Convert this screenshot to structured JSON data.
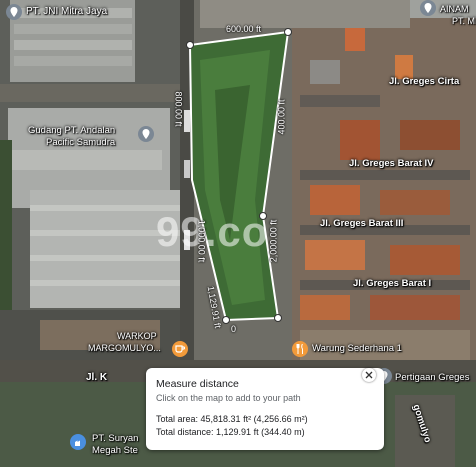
{
  "place_labels": {
    "pt_jni": "PT. JNI Mitra Jaya",
    "ainam": "AINAM",
    "pt_mi": "PT. MI",
    "gudang_1": "Gudang PT. Andalan",
    "gudang_2": "Pacific Samudra",
    "warkop_1": "WARKOP",
    "warkop_2": "MARGOMULYO...",
    "warung": "Warung Sederhana 1",
    "pertigaan": "Pertigaan Greges",
    "pt_suryan_1": "PT. Suryan",
    "pt_suryan_2": "Megah Ste"
  },
  "street_labels": {
    "greges_cirta": "Jl. Greges Cirta",
    "greges_barat_iv": "Jl. Greges Barat IV",
    "greges_barat_iii": "Jl. Greges Barat III",
    "greges_barat_i": "Jl. Greges Barat I",
    "jl_k": "Jl. K",
    "margomulyo": "gomulyo"
  },
  "segment_labels": {
    "top": "600.00 ft",
    "left_upper": "800.00 ft",
    "left_lower": "1,000.00 ft",
    "right_upper": "400.00 ft",
    "right_lower": "2,000.00 ft",
    "bottom": "1,129.91 ft",
    "zero": "0"
  },
  "watermark": "99.co",
  "measure_panel": {
    "title": "Measure distance",
    "hint": "Click on the map to add to your path",
    "total_area": "Total area: 45,818.31 ft² (4,256.66 m²)",
    "total_distance": "Total distance: 1,129.91 ft (344.40 m)"
  },
  "colors": {
    "measure_line": "#ffffff",
    "poi_gray": "#7b8794",
    "poi_orange": "#f29a3a",
    "poi_blue": "#4a8fe0"
  },
  "icons": {
    "close": "close-icon",
    "poi_pin": "pin-icon",
    "food": "fork-knife-icon",
    "cafe": "cup-icon",
    "industry": "building-icon"
  }
}
